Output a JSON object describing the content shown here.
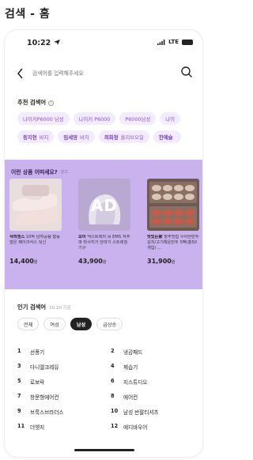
{
  "page_title": "검색 - 홈",
  "status": {
    "time": "10:22",
    "network": "LTE"
  },
  "search": {
    "placeholder": "검색어를 입력해주세요"
  },
  "recommended": {
    "title": "추천 검색어",
    "row1": [
      "나이키P6000 남성",
      "나이키 P6000",
      "P6000남성",
      "나이"
    ],
    "row2": [
      {
        "brand": "동지현",
        "term": "바지"
      },
      {
        "brand": "임세영",
        "term": "바지"
      },
      {
        "brand": "최화정",
        "term": "올리브오일"
      },
      {
        "brand": "한예슬",
        "term": ""
      }
    ]
  },
  "ad_panel": {
    "title": "이런 상품 어떠세요?",
    "sub": "광고",
    "ad_label": "AD",
    "products": [
      {
        "brand": "삭피엔스",
        "desc": "10박 남여공용 발등덮은 페이크삭스 덧신",
        "price": "14,400",
        "unit": "원"
      },
      {
        "brand": "오아",
        "desc": "넥스트레저 목 EMS 저주파 마사지기 안마기 스트레칭 기구",
        "price": "43,900",
        "unit": "원"
      },
      {
        "brand": "맛있는家",
        "desc": "정주맛집 우아한만두 김치/고기해운만두 5팩(총50개입) …",
        "price": "31,900",
        "unit": "원"
      }
    ]
  },
  "popular": {
    "title": "인기 검색어",
    "time": "10:20 기준",
    "tabs": [
      "전체",
      "여성",
      "남성",
      "급상승"
    ],
    "active_tab": "남성",
    "ranks": [
      {
        "n": "1",
        "t": "선풍기"
      },
      {
        "n": "2",
        "t": "냉감패드"
      },
      {
        "n": "3",
        "t": "다니엘크레뮤"
      },
      {
        "n": "4",
        "t": "제습기"
      },
      {
        "n": "5",
        "t": "로보락"
      },
      {
        "n": "6",
        "t": "지스튜디오"
      },
      {
        "n": "7",
        "t": "창문형에어컨"
      },
      {
        "n": "8",
        "t": "에어컨"
      },
      {
        "n": "9",
        "t": "브룩스브라더스"
      },
      {
        "n": "10",
        "t": "남성 반팔티셔츠"
      },
      {
        "n": "11",
        "t": "더엣지"
      },
      {
        "n": "12",
        "t": "에디바우어"
      }
    ]
  },
  "colors": {
    "accent": "#8a4fd6",
    "chip_bg": "#f3ebff",
    "ad_bg": "#c9b2ee"
  }
}
